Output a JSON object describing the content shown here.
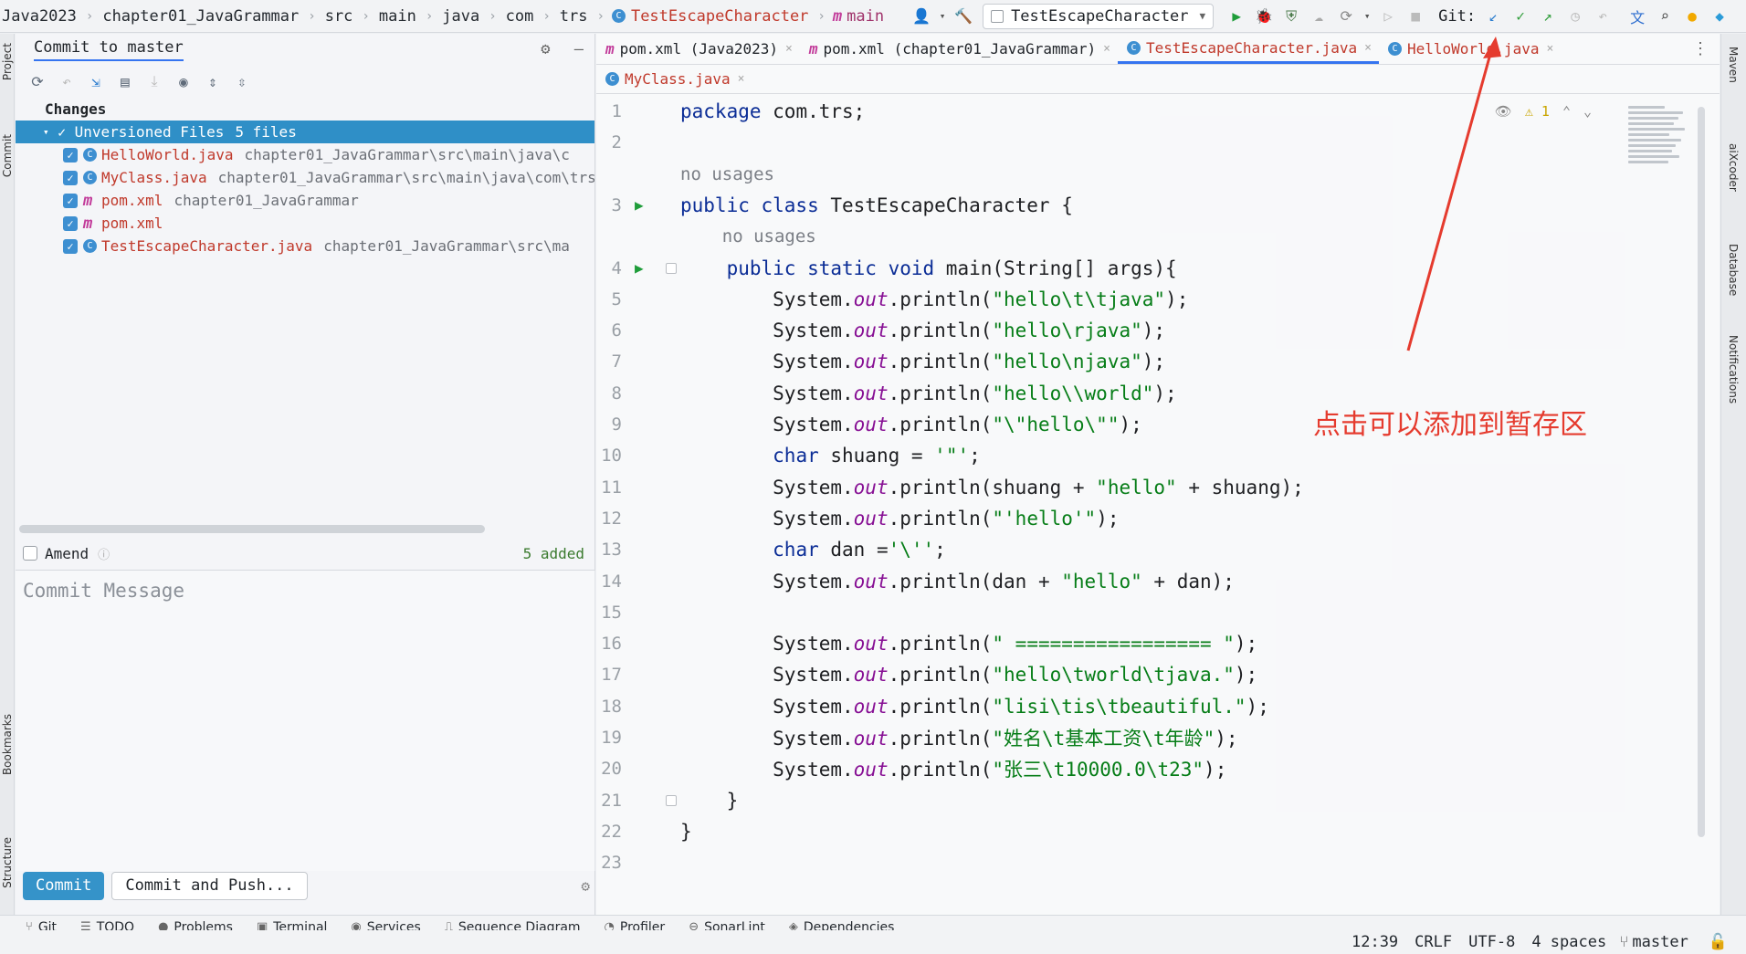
{
  "navbar": {
    "breadcrumbs": [
      "Java2023",
      "chapter01_JavaGrammar",
      "src",
      "main",
      "java",
      "com",
      "trs"
    ],
    "file_crumb": "TestEscapeCharacter",
    "branch_crumb": "main",
    "run_config": "TestEscapeCharacter",
    "git_label": "Git:"
  },
  "left_stripe": {
    "project": "Project",
    "commit": "Commit",
    "bookmarks": "Bookmarks",
    "structure": "Structure"
  },
  "commit_panel": {
    "title": "Commit to master",
    "changes_label": "Changes",
    "group_label": "Unversioned Files",
    "group_count": "5 files",
    "files": [
      {
        "name": "HelloWorld.java",
        "path": "chapter01_JavaGrammar\\src\\main\\java\\c",
        "type": "class"
      },
      {
        "name": "MyClass.java",
        "path": "chapter01_JavaGrammar\\src\\main\\java\\com\\trs",
        "type": "class"
      },
      {
        "name": "pom.xml",
        "path": "chapter01_JavaGrammar",
        "type": "maven"
      },
      {
        "name": "pom.xml",
        "path": "",
        "type": "maven"
      },
      {
        "name": "TestEscapeCharacter.java",
        "path": "chapter01_JavaGrammar\\src\\ma",
        "type": "class"
      }
    ],
    "amend_label": "Amend",
    "added_label": "5 added",
    "message_placeholder": "Commit Message",
    "commit_button": "Commit",
    "commit_push_button": "Commit and Push..."
  },
  "editor": {
    "tabs_row1": [
      {
        "label": "pom.xml (Java2023)",
        "type": "maven",
        "active": false
      },
      {
        "label": "pom.xml (chapter01_JavaGrammar)",
        "type": "maven",
        "active": false
      },
      {
        "label": "TestEscapeCharacter.java",
        "type": "class",
        "active": true
      },
      {
        "label": "HelloWorld.java",
        "type": "class",
        "active": false
      }
    ],
    "tabs_row2": [
      {
        "label": "MyClass.java",
        "type": "class",
        "active": false
      }
    ],
    "warning_count": "1",
    "code": [
      {
        "n": "1",
        "html": "<span class='kw'>package</span> com.trs;"
      },
      {
        "n": "2",
        "html": ""
      },
      {
        "n": "",
        "hint": "no usages"
      },
      {
        "n": "3",
        "run": true,
        "html": "<span class='kw'>public class</span> TestEscapeCharacter {"
      },
      {
        "n": "",
        "hint": "    no usages"
      },
      {
        "n": "4",
        "run": true,
        "fold": true,
        "html": "    <span class='kw'>public static void</span> main(String[] args){"
      },
      {
        "n": "5",
        "html": "        System.<span class='fld'>out</span>.println(<span class='str'>\"hello\\t\\tjava\"</span>);"
      },
      {
        "n": "6",
        "html": "        System.<span class='fld'>out</span>.println(<span class='str'>\"hello\\rjava\"</span>);"
      },
      {
        "n": "7",
        "html": "        System.<span class='fld'>out</span>.println(<span class='str'>\"hello\\njava\"</span>);"
      },
      {
        "n": "8",
        "html": "        System.<span class='fld'>out</span>.println(<span class='str'>\"hello\\\\world\"</span>);"
      },
      {
        "n": "9",
        "html": "        System.<span class='fld'>out</span>.println(<span class='str'>\"\\\"hello\\\"\"</span>);"
      },
      {
        "n": "10",
        "html": "        <span class='kw'>char</span> shuang = <span class='str'>'\"'</span>;"
      },
      {
        "n": "11",
        "html": "        System.<span class='fld'>out</span>.println(shuang + <span class='str'>\"hello\"</span> + shuang);"
      },
      {
        "n": "12",
        "html": "        System.<span class='fld'>out</span>.println(<span class='str'>\"'hello'\"</span>);"
      },
      {
        "n": "13",
        "html": "        <span class='kw'>char</span> dan =<span class='str'>'\\''</span>;"
      },
      {
        "n": "14",
        "html": "        System.<span class='fld'>out</span>.println(dan + <span class='str'>\"hello\"</span> + dan);"
      },
      {
        "n": "15",
        "html": ""
      },
      {
        "n": "16",
        "html": "        System.<span class='fld'>out</span>.println(<span class='str'>\" ================= \"</span>);"
      },
      {
        "n": "17",
        "html": "        System.<span class='fld'>out</span>.println(<span class='str'>\"hello\\tworld\\tjava.\"</span>);"
      },
      {
        "n": "18",
        "html": "        System.<span class='fld'>out</span>.println(<span class='str'>\"lisi\\tis\\tbeautiful.\"</span>);"
      },
      {
        "n": "19",
        "html": "        System.<span class='fld'>out</span>.println(<span class='str'>\"姓名\\t基本工资\\t年龄\"</span>);"
      },
      {
        "n": "20",
        "html": "        System.<span class='fld'>out</span>.println(<span class='str'>\"张三\\t10000.0\\t23\"</span>);"
      },
      {
        "n": "21",
        "fold": true,
        "html": "    }"
      },
      {
        "n": "22",
        "html": "}"
      },
      {
        "n": "23",
        "html": ""
      }
    ]
  },
  "annotation": "点击可以添加到暂存区",
  "right_stripe": {
    "maven": "Maven",
    "aixcoder": "aiXcoder",
    "database": "Database",
    "notifications": "Notifications"
  },
  "tool_windows": [
    "Git",
    "TODO",
    "Problems",
    "Terminal",
    "Services",
    "Sequence Diagram",
    "Profiler",
    "SonarLint",
    "Dependencies"
  ],
  "statusbar": {
    "position": "12:39",
    "line_sep": "CRLF",
    "encoding": "UTF-8",
    "indent": "4 spaces",
    "branch": "master"
  },
  "colors": {
    "accent": "#3574f0",
    "keyword": "#0b2d96",
    "string": "#067d17",
    "field": "#871094",
    "annotation": "#e53b2e",
    "selection": "#2f8fc7"
  }
}
